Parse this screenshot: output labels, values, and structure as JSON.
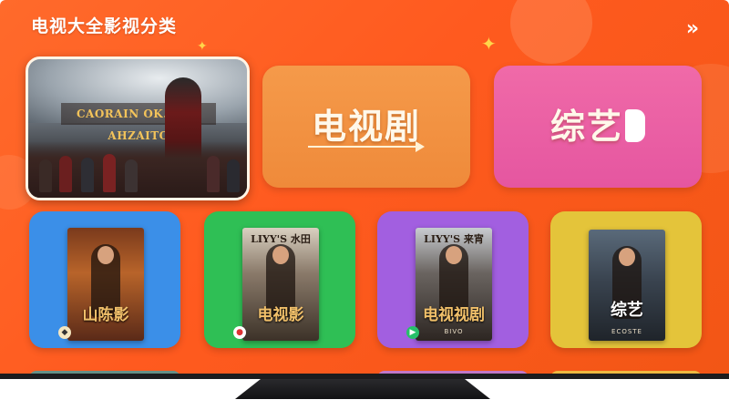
{
  "header": {
    "title": "电视大全影视分类",
    "more_icon": "double-chevron-right-icon"
  },
  "top_row": {
    "featured": {
      "billboard": "CAORAIN OK. DRC AHZAITO"
    },
    "categories": [
      {
        "label": "电视剧"
      },
      {
        "label": "综艺"
      }
    ]
  },
  "bottom_row": [
    {
      "color": "#3b8fe8",
      "poster_top": "",
      "poster_title": "山陈影",
      "poster_sub": ""
    },
    {
      "color": "#2fbf55",
      "poster_top": "LIYY'S 水田",
      "poster_title": "电视影",
      "poster_sub": ""
    },
    {
      "color": "#a25fe0",
      "poster_top": "LIYY'S 来宵",
      "poster_title": "电视视剧",
      "poster_sub": "BIVO"
    },
    {
      "color": "#e4c43a",
      "poster_top": "",
      "poster_title": "综艺",
      "poster_sub": "ECOSTE"
    }
  ]
}
